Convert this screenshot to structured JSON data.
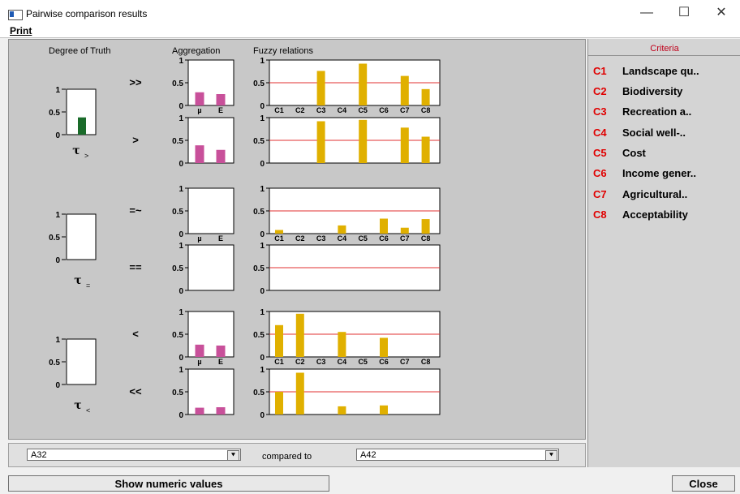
{
  "window": {
    "title": "Pairwise comparison results",
    "minimize_glyph": "—",
    "maximize_glyph": "☐",
    "close_glyph": "✕"
  },
  "menu": {
    "print": "Print"
  },
  "section_labels": {
    "degree_of_truth": "Degree of Truth",
    "aggregation": "Aggregation",
    "fuzzy_relations": "Fuzzy relations"
  },
  "criteria_panel": {
    "header": "Criteria",
    "items": [
      {
        "code": "C1",
        "name": "Landscape qu.."
      },
      {
        "code": "C2",
        "name": "Biodiversity"
      },
      {
        "code": "C3",
        "name": "Recreation a.."
      },
      {
        "code": "C4",
        "name": "Social well-.."
      },
      {
        "code": "C5",
        "name": "Cost"
      },
      {
        "code": "C6",
        "name": "Income gener.."
      },
      {
        "code": "C7",
        "name": "Agricultural.."
      },
      {
        "code": "C8",
        "name": "Acceptability"
      }
    ]
  },
  "colors": {
    "dot_bar": "#1a6b2a",
    "agg_bar": "#c8509a",
    "rel_bar": "#e0b000",
    "threshold": "#e03030",
    "crit_code": "#e00000"
  },
  "chart_data": {
    "type": "bar",
    "degree_of_truth": [
      {
        "symbol": "τ",
        "subscript": ">",
        "ticks": [
          "1",
          "0.5",
          "0"
        ],
        "value": 0.38
      },
      {
        "symbol": "τ",
        "subscript": "=",
        "ticks": [
          "1",
          "0.5",
          "0"
        ],
        "value": 0
      },
      {
        "symbol": "τ",
        "subscript": "<",
        "ticks": [
          "1",
          "0.5",
          "0"
        ],
        "value": 0
      }
    ],
    "relations": [
      {
        "symbol": ">>",
        "aggregation": {
          "categories": [
            "µ",
            "E"
          ],
          "values": [
            0.29,
            0.25
          ],
          "show_x_labels": true
        },
        "fuzzy": {
          "categories": [
            "C1",
            "C2",
            "C3",
            "C4",
            "C5",
            "C6",
            "C7",
            "C8"
          ],
          "values": [
            0,
            0,
            0.76,
            0,
            0.92,
            0,
            0.65,
            0.36
          ],
          "threshold": 0.5,
          "show_x_labels": true
        }
      },
      {
        "symbol": ">",
        "aggregation": {
          "categories": [
            "µ",
            "E"
          ],
          "values": [
            0.39,
            0.29
          ],
          "show_x_labels": false
        },
        "fuzzy": {
          "categories": [
            "C1",
            "C2",
            "C3",
            "C4",
            "C5",
            "C6",
            "C7",
            "C8"
          ],
          "values": [
            0,
            0,
            0.92,
            0,
            0.95,
            0,
            0.78,
            0.58
          ],
          "threshold": 0.5,
          "show_x_labels": false
        }
      },
      {
        "symbol": "=~",
        "aggregation": {
          "categories": [
            "µ",
            "E"
          ],
          "values": [
            0,
            0
          ],
          "show_x_labels": true
        },
        "fuzzy": {
          "categories": [
            "C1",
            "C2",
            "C3",
            "C4",
            "C5",
            "C6",
            "C7",
            "C8"
          ],
          "values": [
            0.08,
            0,
            0,
            0.18,
            0,
            0.33,
            0.13,
            0.32
          ],
          "threshold": 0.5,
          "show_x_labels": true
        }
      },
      {
        "symbol": "==",
        "aggregation": {
          "categories": [
            "µ",
            "E"
          ],
          "values": [
            0,
            0
          ],
          "show_x_labels": false
        },
        "fuzzy": {
          "categories": [
            "C1",
            "C2",
            "C3",
            "C4",
            "C5",
            "C6",
            "C7",
            "C8"
          ],
          "values": [
            0,
            0,
            0,
            0,
            0,
            0,
            0,
            0
          ],
          "threshold": 0.5,
          "show_x_labels": false
        }
      },
      {
        "symbol": "<",
        "aggregation": {
          "categories": [
            "µ",
            "E"
          ],
          "values": [
            0.27,
            0.25
          ],
          "show_x_labels": true
        },
        "fuzzy": {
          "categories": [
            "C1",
            "C2",
            "C3",
            "C4",
            "C5",
            "C6",
            "C7",
            "C8"
          ],
          "values": [
            0.7,
            0.95,
            0,
            0.55,
            0,
            0.42,
            0,
            0
          ],
          "threshold": 0.5,
          "show_x_labels": true
        }
      },
      {
        "symbol": "<<",
        "aggregation": {
          "categories": [
            "µ",
            "E"
          ],
          "values": [
            0.15,
            0.16
          ],
          "show_x_labels": false
        },
        "fuzzy": {
          "categories": [
            "C1",
            "C2",
            "C3",
            "C4",
            "C5",
            "C6",
            "C7",
            "C8"
          ],
          "values": [
            0.5,
            0.92,
            0,
            0.18,
            0,
            0.2,
            0,
            0
          ],
          "threshold": 0.5,
          "show_x_labels": false
        }
      }
    ],
    "y_ticks": [
      "1",
      "0.5",
      "0"
    ],
    "ylim": [
      0,
      1
    ]
  },
  "bottom": {
    "alt_left": "A32",
    "compared_to": "compared to",
    "alt_right": "A42",
    "dropdown_arrow": "⯆"
  },
  "buttons": {
    "show_numeric": "Show numeric values",
    "close": "Close"
  }
}
